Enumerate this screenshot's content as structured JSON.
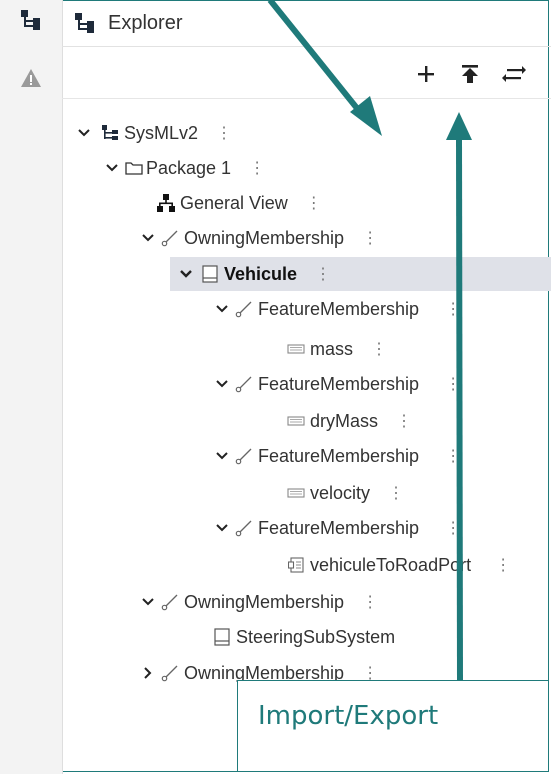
{
  "header": {
    "title": "Explorer"
  },
  "left_rail": {
    "items": [
      {
        "icon": "explorer-tree-icon"
      },
      {
        "icon": "warning-icon"
      }
    ]
  },
  "toolbar": {
    "buttons": [
      {
        "icon": "plus-icon"
      },
      {
        "icon": "upload-icon"
      },
      {
        "icon": "swap-icon"
      }
    ]
  },
  "tree": {
    "rows": [
      {
        "label": "SysMLv2",
        "icon": "model-tree-icon",
        "expanded": true
      },
      {
        "label": "Package 1",
        "icon": "folder-icon",
        "expanded": true
      },
      {
        "label": "General View",
        "icon": "diagram-icon"
      },
      {
        "label": "OwningMembership",
        "icon": "membership-icon",
        "expanded": true
      },
      {
        "label": "Vehicule",
        "icon": "part-definition-icon",
        "expanded": true,
        "selected": true
      },
      {
        "label": "FeatureMembership",
        "icon": "membership-icon",
        "expanded": true
      },
      {
        "label": "mass",
        "icon": "attribute-icon"
      },
      {
        "label": "FeatureMembership",
        "icon": "membership-icon",
        "expanded": true
      },
      {
        "label": "dryMass",
        "icon": "attribute-icon"
      },
      {
        "label": "FeatureMembership",
        "icon": "membership-icon",
        "expanded": true
      },
      {
        "label": "velocity",
        "icon": "attribute-icon"
      },
      {
        "label": "FeatureMembership",
        "icon": "membership-icon",
        "expanded": true
      },
      {
        "label": "vehiculeToRoadPort",
        "icon": "port-icon"
      },
      {
        "label": "OwningMembership",
        "icon": "membership-icon",
        "expanded": true
      },
      {
        "label": "SteeringSubSystem",
        "icon": "part-definition-icon"
      },
      {
        "label": "OwningMembership",
        "icon": "membership-icon",
        "expanded": false
      }
    ]
  },
  "callout": {
    "text": "Import/Export"
  },
  "colors": {
    "annotation": "#1f7a7a",
    "selection": "#dfe1e8"
  }
}
